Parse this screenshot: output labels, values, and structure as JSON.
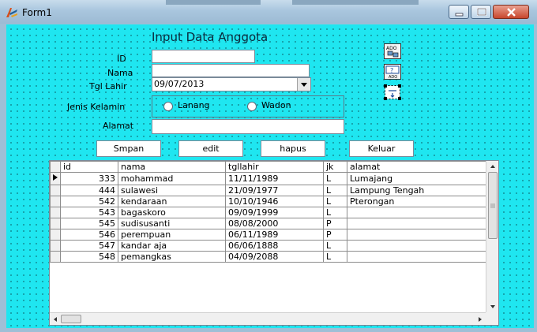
{
  "window": {
    "title": "Form1"
  },
  "form": {
    "heading": "Input Data Anggota",
    "labels": {
      "id": "ID",
      "nama": "Nama",
      "tgl_lahir": "Tgl Lahir",
      "jenis_kelamin": "Jenis Kelamin",
      "alamat": "Alamat"
    },
    "values": {
      "id": "",
      "nama": "",
      "tgl_lahir": "09/07/2013",
      "alamat": ""
    },
    "gender_options": [
      "Lanang",
      "Wadon"
    ]
  },
  "buttons": {
    "simpan": "Smpan",
    "edit": "edit",
    "hapus": "hapus",
    "keluar": "Keluar"
  },
  "grid": {
    "columns": [
      "id",
      "nama",
      "tgllahir",
      "jk",
      "alamat"
    ],
    "rows": [
      [
        "333",
        "mohammad",
        "11/11/1989",
        "L",
        "Lumajang"
      ],
      [
        "444",
        "sulawesi",
        "21/09/1977",
        "L",
        "Lampung Tengah"
      ],
      [
        "542",
        "kendaraan",
        "10/10/1946",
        "L",
        "Pterongan"
      ],
      [
        "543",
        "bagaskoro",
        "09/09/1999",
        "L",
        ""
      ],
      [
        "545",
        "sudisusanti",
        "08/08/2000",
        "P",
        ""
      ],
      [
        "546",
        "perempuan",
        "06/11/1989",
        "P",
        ""
      ],
      [
        "547",
        "kandar aja",
        "06/06/1888",
        "L",
        ""
      ],
      [
        "548",
        "pemangkas",
        "04/09/2088",
        "L",
        ""
      ]
    ],
    "current_row": 0
  },
  "icons": [
    "app-icon",
    "ado-connection-icon",
    "ado-dataset-icon",
    "datasource-icon",
    "minimize-icon",
    "maximize-icon",
    "close-icon"
  ],
  "colors": {
    "form_background": "#1fe6f0",
    "titlebar": "#a9c6de",
    "close_button": "#c8462c"
  }
}
